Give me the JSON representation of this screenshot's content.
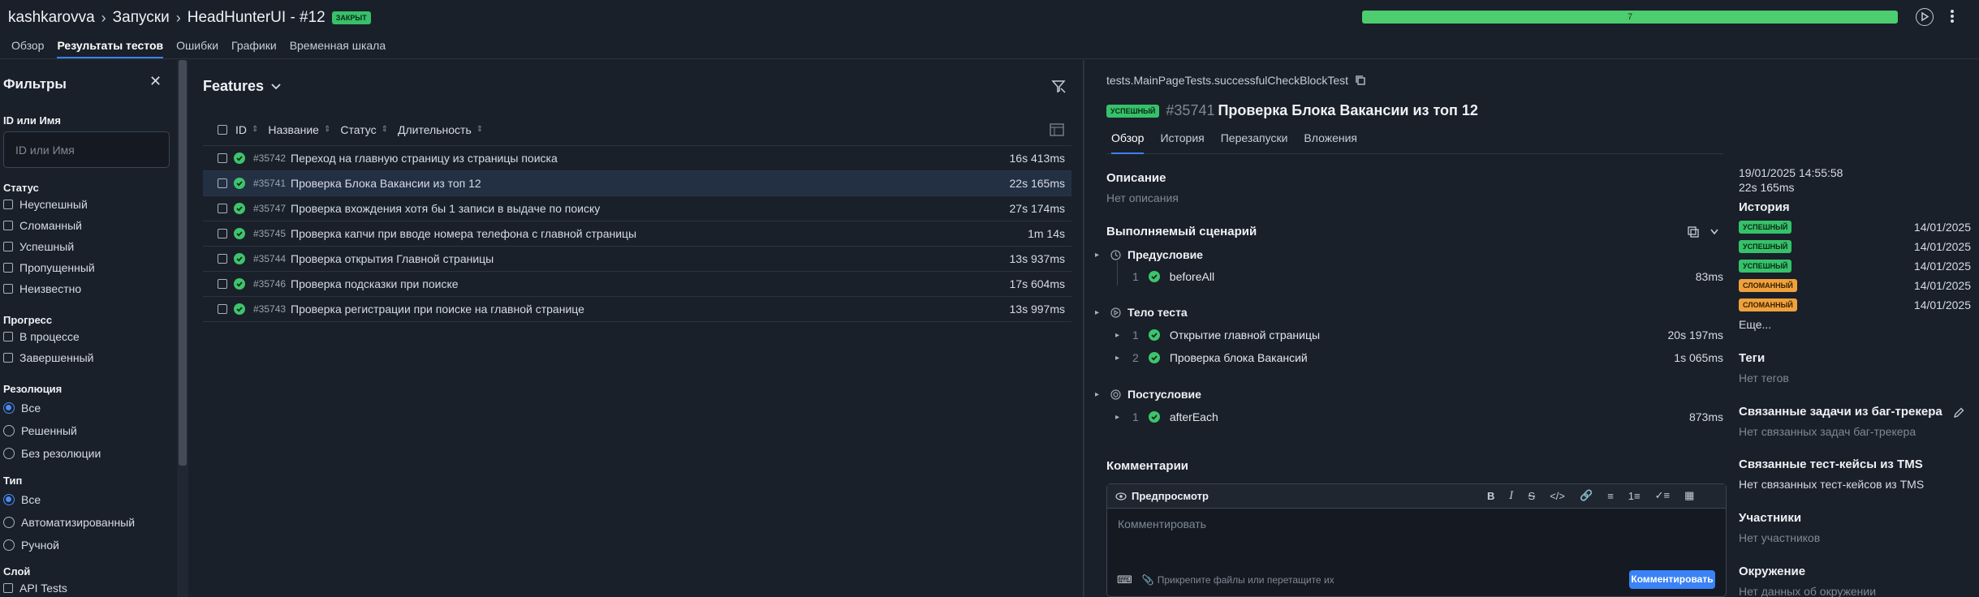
{
  "header": {
    "breadcrumbs": [
      "kashkarovva",
      "Запуски",
      "HeadHunterUI - #12"
    ],
    "launch_badge": "ЗАКРЫТ",
    "progress_value": "7",
    "progress_fraction": 1.0
  },
  "tabs": [
    "Обзор",
    "Результаты тестов",
    "Ошибки",
    "Графики",
    "Временная шкала"
  ],
  "active_tab": "Результаты тестов",
  "filters": {
    "title": "Фильтры",
    "id_label": "ID или Имя",
    "id_placeholder": "ID или Имя",
    "status_label": "Статус",
    "status_options": [
      "Неуспешный",
      "Сломанный",
      "Успешный",
      "Пропущенный",
      "Неизвестно"
    ],
    "progress_label": "Прогресс",
    "progress_options": [
      "В процессе",
      "Завершенный"
    ],
    "resolution_label": "Резолюция",
    "resolution_options": [
      "Все",
      "Решенный",
      "Без резолюции"
    ],
    "resolution_selected": "Все",
    "type_label": "Тип",
    "type_options": [
      "Все",
      "Автоматизированный",
      "Ручной"
    ],
    "type_selected": "Все",
    "layer_label": "Слой",
    "layer_options": [
      "API Tests"
    ]
  },
  "features": {
    "title": "Features",
    "columns": [
      "ID",
      "Название",
      "Статус",
      "Длительность"
    ],
    "rows": [
      {
        "id": "#35742",
        "name": "Переход на главную страницу из страницы поиска",
        "duration": "16s 413ms",
        "selected": false
      },
      {
        "id": "#35741",
        "name": "Проверка Блока Вакансии из топ 12",
        "duration": "22s 165ms",
        "selected": true
      },
      {
        "id": "#35747",
        "name": "Проверка вхождения хотя бы 1 записи в выдаче по поиску",
        "duration": "27s 174ms",
        "selected": false
      },
      {
        "id": "#35745",
        "name": "Проверка капчи при вводе номера телефона с главной страницы",
        "duration": "1m 14s",
        "selected": false
      },
      {
        "id": "#35744",
        "name": "Проверка открытия Главной страницы",
        "duration": "13s 937ms",
        "selected": false
      },
      {
        "id": "#35746",
        "name": "Проверка подсказки при поиске",
        "duration": "17s 604ms",
        "selected": false
      },
      {
        "id": "#35743",
        "name": "Проверка регистрации при поиске на главной странице",
        "duration": "13s 997ms",
        "selected": false
      }
    ]
  },
  "detail": {
    "full_name": "tests.MainPageTests.successfulCheckBlockTest",
    "status_badge": "УСПЕШНЫЙ",
    "id": "#35741",
    "title": "Проверка Блока Вакансии из топ 12",
    "tabs": [
      "Обзор",
      "История",
      "Перезапуски",
      "Вложения"
    ],
    "active_tab": "Обзор",
    "description_label": "Описание",
    "description_value": "Нет описания",
    "scenario_label": "Выполняемый сценарий",
    "precondition_label": "Предусловие",
    "precondition_steps": [
      {
        "num": "1",
        "name": "beforeAll",
        "duration": "83ms"
      }
    ],
    "body_label": "Тело теста",
    "body_steps": [
      {
        "num": "1",
        "name": "Открытие главной страницы",
        "duration": "20s 197ms"
      },
      {
        "num": "2",
        "name": "Проверка блока Вакансий",
        "duration": "1s 065ms"
      }
    ],
    "postcondition_label": "Постусловие",
    "postcondition_steps": [
      {
        "num": "1",
        "name": "afterEach",
        "duration": "873ms"
      }
    ],
    "comments_label": "Комментарии",
    "preview_label": "Предпросмотр",
    "comment_placeholder": "Комментировать",
    "attach_hint": "Прикрепите файлы или перетащите их",
    "comment_button": "Комментировать"
  },
  "side": {
    "date": "19/01/2025 14:55:58",
    "duration": "22s 165ms",
    "history_label": "История",
    "history": [
      {
        "status": "УСПЕШНЫЙ",
        "date": "14/01/2025",
        "color": "#36c16a"
      },
      {
        "status": "УСПЕШНЫЙ",
        "date": "14/01/2025",
        "color": "#36c16a"
      },
      {
        "status": "УСПЕШНЫЙ",
        "date": "14/01/2025",
        "color": "#36c16a"
      },
      {
        "status": "СЛОМАННЫЙ",
        "date": "14/01/2025",
        "color": "#f0a13c"
      },
      {
        "status": "СЛОМАННЫЙ",
        "date": "14/01/2025",
        "color": "#f0a13c"
      }
    ],
    "more": "Еще...",
    "tags_label": "Теги",
    "tags_value": "Нет тегов",
    "issues_label": "Связанные задачи из баг-трекера",
    "issues_value": "Нет связанных задач баг-трекера",
    "tms_label": "Связанные тест-кейсы из TMS",
    "tms_value": "Нет связанных тест-кейсов из TMS",
    "members_label": "Участники",
    "members_value": "Нет участников",
    "env_label": "Окружение",
    "env_value": "Нет данных об окружении"
  }
}
